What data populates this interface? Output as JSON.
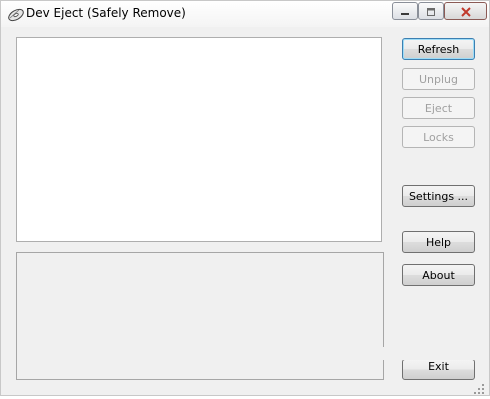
{
  "window": {
    "title": "Dev Eject (Safely Remove)"
  },
  "caption_buttons": {
    "minimize": "minimize-icon",
    "maximize": "maximize-icon",
    "close": "close-icon",
    "close_color": "#c0392b"
  },
  "buttons": {
    "refresh": "Refresh",
    "unplug": "Unplug",
    "eject": "Eject",
    "locks": "Locks",
    "settings": "Settings ...",
    "help": "Help",
    "about": "About",
    "exit": "Exit"
  },
  "colors": {
    "window_bg": "#f0f0f0",
    "disabled_text": "#a0a0a0"
  }
}
